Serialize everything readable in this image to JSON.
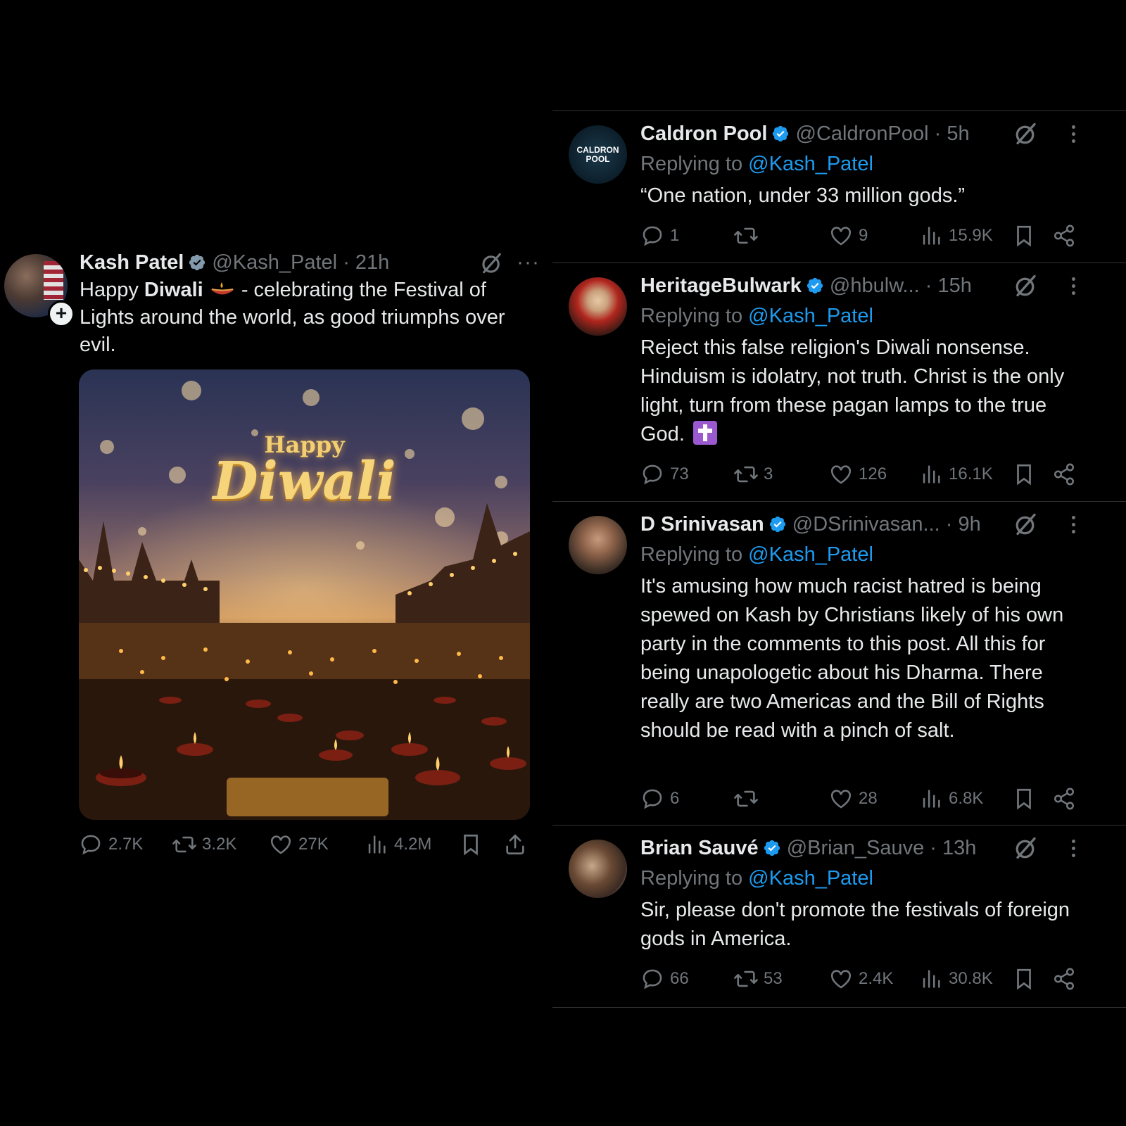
{
  "colors": {
    "background": "#000000",
    "text": "#e7e9ea",
    "muted": "#71767b",
    "link": "#1d9bf0",
    "divider": "#2f3336"
  },
  "main_post": {
    "author_name": "Kash Patel",
    "handle": "@Kash_Patel",
    "time": "· 21h",
    "text_part1": "Happy ",
    "text_bold": "Diwali",
    "text_part2": " - celebrating the Festival of Lights around the world, as good triumphs over evil.",
    "image_text_happy": "Happy",
    "image_text_diwali": "Diwali",
    "stats": {
      "replies": "2.7K",
      "reposts": "3.2K",
      "likes": "27K",
      "views": "4.2M"
    },
    "icons": [
      "verified-badge-icon",
      "grok-icon",
      "more-icon",
      "reply-icon",
      "repost-icon",
      "like-icon",
      "views-icon",
      "bookmark-icon",
      "share-icon"
    ]
  },
  "replies": [
    {
      "author_name": "Caldron Pool",
      "handle": "@CaldronPool",
      "time": "· 5h",
      "avatar_text": "CALDRON POOL",
      "replying_prefix": "Replying to ",
      "replying_to": "@Kash_Patel",
      "text": "“One nation, under 33 million gods.”",
      "stats": {
        "replies": "1",
        "reposts": "",
        "likes": "9",
        "views": "15.9K"
      }
    },
    {
      "author_name": "HeritageBulwark",
      "handle": "@hbulw...",
      "time": " · 15h",
      "replying_prefix": "Replying to ",
      "replying_to": "@Kash_Patel",
      "text": "Reject this false religion's Diwali nonsense. Hinduism is idolatry, not truth. Christ is the only light, turn from these pagan lamps to the true God.",
      "stats": {
        "replies": "73",
        "reposts": "3",
        "likes": "126",
        "views": "16.1K"
      }
    },
    {
      "author_name": "D Srinivasan",
      "handle": "@DSrinivasan...",
      "time": " · 9h",
      "replying_prefix": "Replying to ",
      "replying_to": "@Kash_Patel",
      "text": "It's amusing how much racist hatred is being spewed on Kash by Christians likely of his own party in the comments to this post. All this for being unapologetic about his Dharma. There really are two Americas and the Bill of Rights should be read with a pinch of salt.",
      "stats": {
        "replies": "6",
        "reposts": "",
        "likes": "28",
        "views": "6.8K"
      }
    },
    {
      "author_name": "Brian Sauvé",
      "handle": "@Brian_Sauve",
      "time": "· 13h",
      "replying_prefix": "Replying to ",
      "replying_to": "@Kash_Patel",
      "text": "Sir, please don't promote the festivals of foreign gods in America.",
      "stats": {
        "replies": "66",
        "reposts": "53",
        "likes": "2.4K",
        "views": "30.8K"
      }
    }
  ]
}
